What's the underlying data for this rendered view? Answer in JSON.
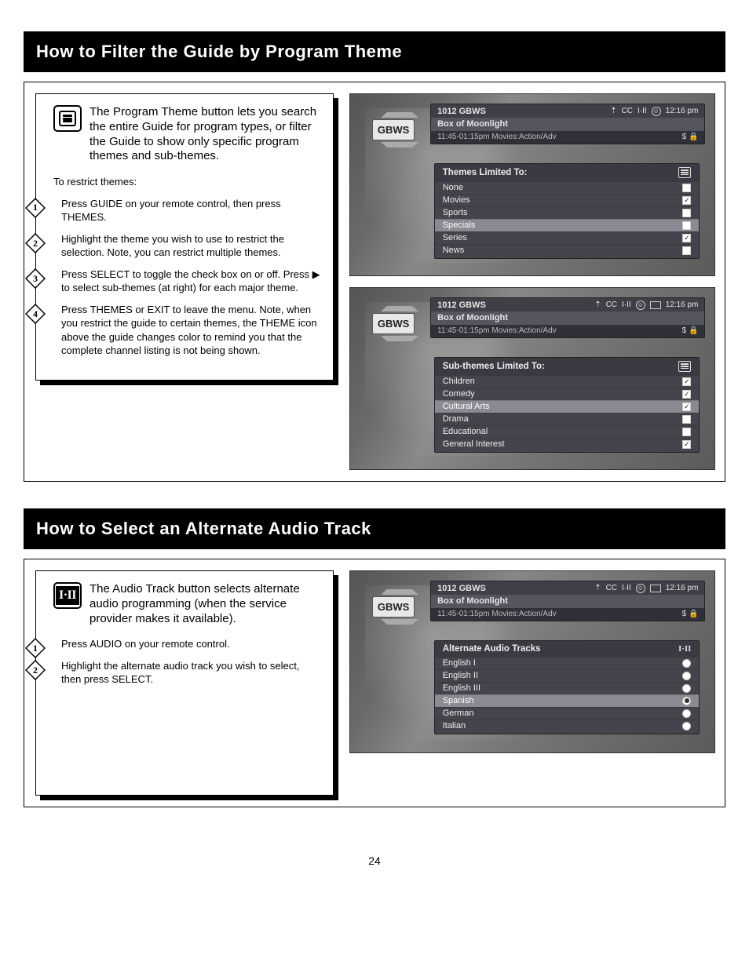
{
  "sections": {
    "themes": {
      "header": "How to Filter the Guide by Program Theme",
      "headText": "The Program Theme button lets you search the entire Guide for program types, or filter the Guide to show only specific program themes and sub-themes.",
      "intro": "To restrict themes:",
      "steps": [
        "Press GUIDE on your remote control, then press THEMES.",
        "Highlight the theme you wish to use to restrict the selection. Note, you can restrict multiple themes.",
        "Press SELECT to toggle the check box on or off. Press  ▶  to select sub-themes (at right) for each major theme.",
        "Press THEMES or EXIT to leave the menu. Note, when you restrict the guide to certain themes, the THEME icon above the guide changes color to remind you that the complete channel listing is not being shown."
      ]
    },
    "audio": {
      "header": "How to Select an Alternate Audio Track",
      "headText": "The Audio Track button selects alternate audio programming (when the service provider makes it available).",
      "steps": [
        "Press AUDIO on your remote control.",
        "Highlight the alternate audio track you wish to select, then press SELECT."
      ]
    }
  },
  "common": {
    "channelBadge": "GBWS",
    "channelLine": "1012 GBWS",
    "programTitle": "Box of Moonlight",
    "timeLine": "11:45-01:15pm Movies:Action/Adv",
    "iconCC": "CC",
    "iconIII": "I·II",
    "clock": "12:16 pm",
    "payLock": "$ 🔒",
    "antenna": "⇡"
  },
  "themesPanel": {
    "title": "Themes Limited To:",
    "items": [
      {
        "label": "None",
        "checked": false
      },
      {
        "label": "Movies",
        "checked": true
      },
      {
        "label": "Sports",
        "checked": false
      },
      {
        "label": "Specials",
        "checked": false,
        "selected": true
      },
      {
        "label": "Series",
        "checked": true
      },
      {
        "label": "News",
        "checked": false
      }
    ]
  },
  "subthemesPanel": {
    "title": "Sub-themes Limited To:",
    "items": [
      {
        "label": "Children",
        "checked": true
      },
      {
        "label": "Comedy",
        "checked": true
      },
      {
        "label": "Cultural Arts",
        "checked": true,
        "selected": true
      },
      {
        "label": "Drama",
        "checked": false
      },
      {
        "label": "Educational",
        "checked": false
      },
      {
        "label": "General Interest",
        "checked": true
      }
    ]
  },
  "audioPanel": {
    "title": "Alternate Audio Tracks",
    "items": [
      {
        "label": "English I",
        "on": false
      },
      {
        "label": "English II",
        "on": false
      },
      {
        "label": "English III",
        "on": false
      },
      {
        "label": "Spanish",
        "on": true,
        "selected": true
      },
      {
        "label": "German",
        "on": false
      },
      {
        "label": "Italian",
        "on": false
      }
    ]
  },
  "pageNumber": "24"
}
